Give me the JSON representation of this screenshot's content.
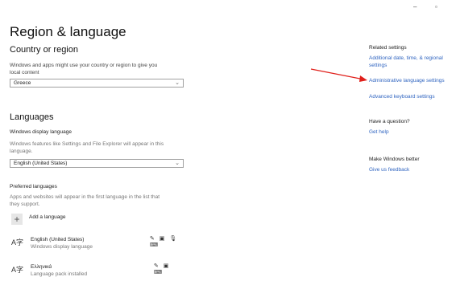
{
  "window": {
    "minimize_glyph": "–",
    "restore_glyph": "▫"
  },
  "page": {
    "title": "Region & language"
  },
  "country": {
    "heading": "Country or region",
    "description_line1": "Windows and apps might use your country or region to give you",
    "description_line2": "local content",
    "selected": "Greece",
    "chevron_icon": "chevron-down-icon"
  },
  "languages": {
    "heading": "Languages",
    "display_language_label": "Windows display language",
    "display_language_desc_line1": "Windows features like Settings and File Explorer will appear in this",
    "display_language_desc_line2": "language.",
    "display_language_selected": "English (United States)",
    "preferred_label": "Preferred languages",
    "preferred_desc_line1": "Apps and websites will appear in the first language in the list that",
    "preferred_desc_line2": "they support.",
    "add_language_label": "Add a language",
    "items": [
      {
        "name": "English (United States)",
        "subtitle": "Windows display language",
        "feature_icons": "✎ ▣ 🎙 ⌨"
      },
      {
        "name": "Ελληνικά",
        "subtitle": "Language pack installed",
        "feature_icons": "✎ ▣ ⌨"
      }
    ]
  },
  "sidebar": {
    "related_heading": "Related settings",
    "related_link1_line1": "Additional date, time, & regional",
    "related_link1_line2": "settings",
    "related_link2": "Administrative language settings",
    "related_link3": "Advanced keyboard settings",
    "question_heading": "Have a question?",
    "help_link": "Get help",
    "better_heading": "Make Windows better",
    "feedback_link": "Give us feedback"
  },
  "colors": {
    "link": "#2f64c0",
    "annotation_arrow": "#e0201b"
  }
}
